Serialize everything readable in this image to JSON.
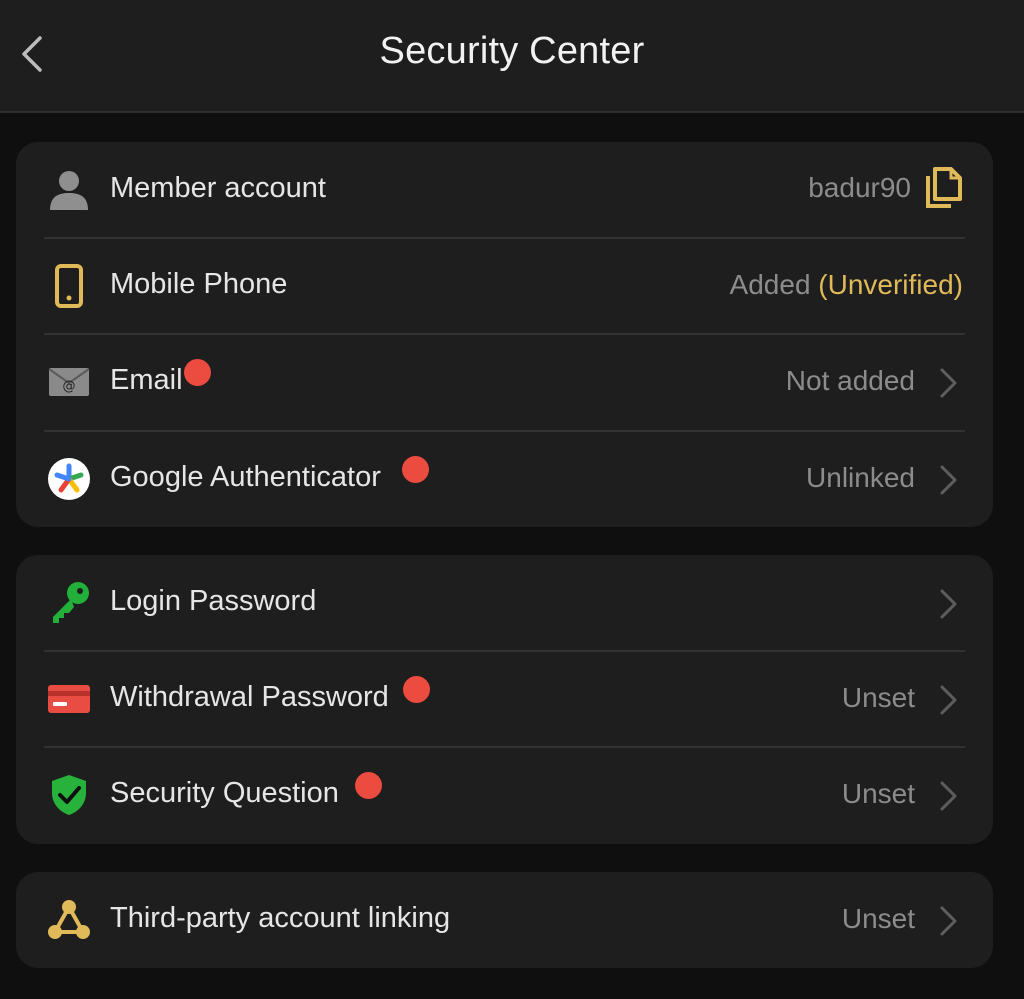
{
  "header": {
    "title": "Security Center"
  },
  "account_section": {
    "member": {
      "label": "Member account",
      "value": "badur90"
    },
    "phone": {
      "label": "Mobile Phone",
      "value_status": "Added",
      "value_note": "(Unverified)"
    },
    "email": {
      "label": "Email",
      "value": "Not added"
    },
    "google": {
      "label": "Google Authenticator",
      "value": "Unlinked"
    }
  },
  "password_section": {
    "login": {
      "label": "Login Password",
      "value": ""
    },
    "withdrawal": {
      "label": "Withdrawal Password",
      "value": "Unset"
    },
    "question": {
      "label": "Security Question",
      "value": "Unset"
    }
  },
  "linking_section": {
    "third_party": {
      "label": "Third-party account linking",
      "value": "Unset"
    }
  },
  "colors": {
    "accent_gold": "#e0b959",
    "notification_red": "#ec4b3f",
    "key_green": "#22b03a",
    "card_red": "#e84c43",
    "shield_green": "#27b23c"
  },
  "icons": [
    "chevron-left-icon",
    "person-icon",
    "phone-icon",
    "envelope-icon",
    "google-authenticator-icon",
    "key-icon",
    "credit-card-icon",
    "shield-check-icon",
    "link-nodes-icon",
    "copy-icon",
    "chevron-right-icon"
  ]
}
